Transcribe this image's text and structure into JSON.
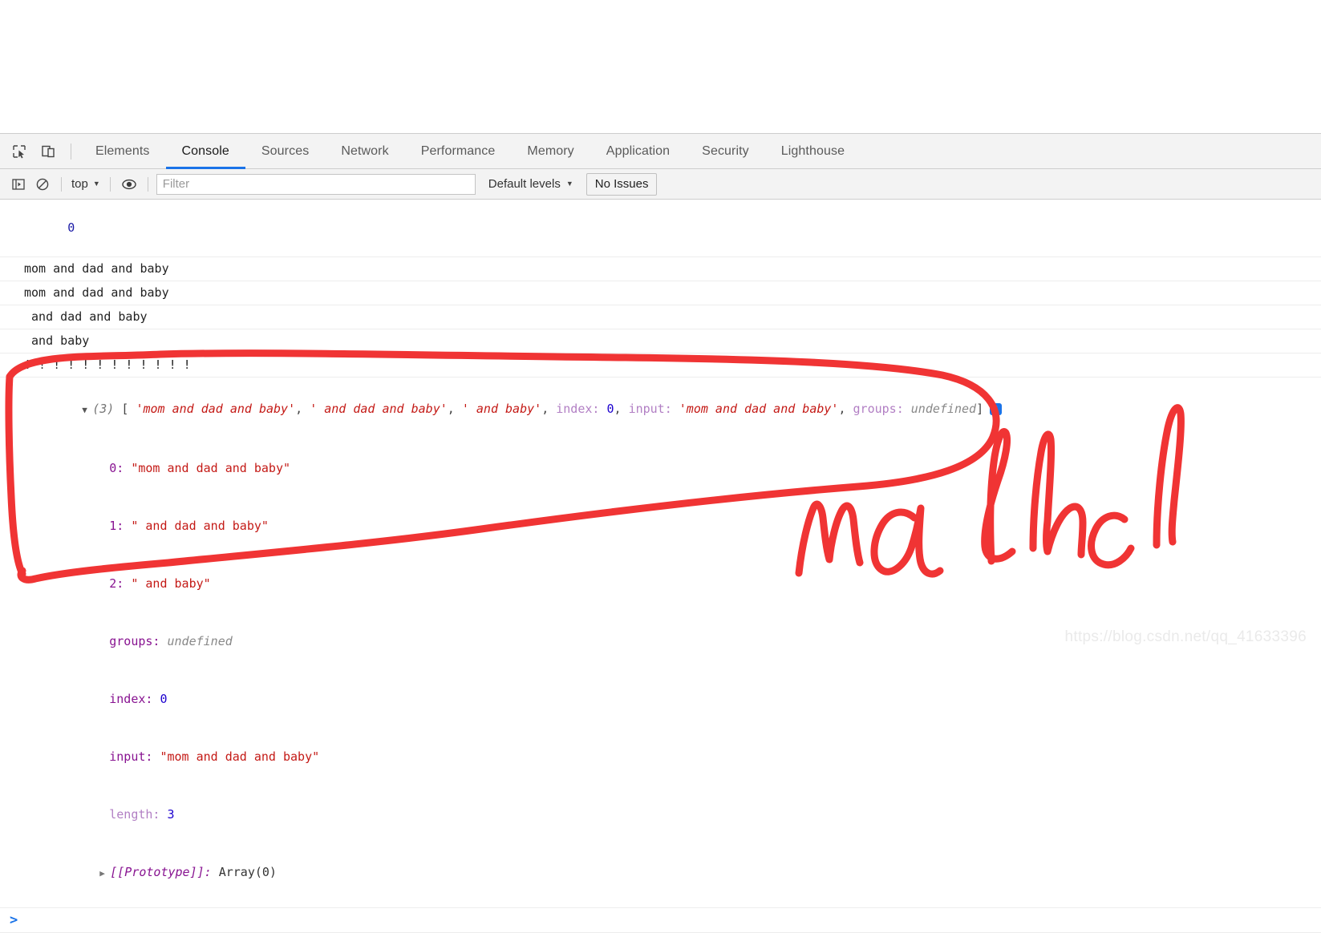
{
  "window": {
    "page_area_background": "#ffffff"
  },
  "devtools": {
    "toolbar_icons": [
      {
        "name": "inspect-element-icon",
        "glyph": "inspect"
      },
      {
        "name": "device-toolbar-icon",
        "glyph": "device"
      }
    ],
    "tabs": [
      {
        "label": "Elements",
        "active": false
      },
      {
        "label": "Console",
        "active": true
      },
      {
        "label": "Sources",
        "active": false
      },
      {
        "label": "Network",
        "active": false
      },
      {
        "label": "Performance",
        "active": false
      },
      {
        "label": "Memory",
        "active": false
      },
      {
        "label": "Application",
        "active": false
      },
      {
        "label": "Security",
        "active": false
      },
      {
        "label": "Lighthouse",
        "active": false
      }
    ],
    "accent_color": "#1a73e8"
  },
  "console_toolbar": {
    "sidebar_toggle_icon": "show-console-sidebar-icon",
    "clear_icon": "clear-console-icon",
    "context_selector": {
      "value": "top",
      "caret": "▼"
    },
    "eye_icon": "live-expression-icon",
    "filter": {
      "value": "",
      "placeholder": "Filter"
    },
    "levels": {
      "value": "Default levels",
      "caret": "▼"
    },
    "issues_button": "No Issues"
  },
  "console_messages": [
    {
      "type": "number",
      "text": "0"
    },
    {
      "type": "text",
      "text": "mom and dad and baby"
    },
    {
      "type": "text",
      "text": "mom and dad and baby"
    },
    {
      "type": "text",
      "text": " and dad and baby"
    },
    {
      "type": "text",
      "text": " and baby"
    },
    {
      "type": "text",
      "text": "! ! ! ! ! ! ! ! ! ! ! !"
    }
  ],
  "array_result": {
    "expand_arrow": "▼",
    "count_label": "(3)",
    "open_bracket": "[",
    "close_bracket": "]",
    "preview_items": [
      "'mom and dad and baby'",
      "' and dad and baby'",
      "' and baby'"
    ],
    "preview_index_key": "index:",
    "preview_index_value": "0",
    "preview_input_key": "input:",
    "preview_input_value": "'mom and dad and baby'",
    "preview_groups_key": "groups:",
    "preview_groups_value": "undefined",
    "info_badge": "i",
    "properties": [
      {
        "key": "0:",
        "value": "\"mom and dad and baby\"",
        "value_kind": "string"
      },
      {
        "key": "1:",
        "value": "\" and dad and baby\"",
        "value_kind": "string"
      },
      {
        "key": "2:",
        "value": "\" and baby\"",
        "value_kind": "string"
      },
      {
        "key": "groups:",
        "value": "undefined",
        "value_kind": "undefined"
      },
      {
        "key": "index:",
        "value": "0",
        "value_kind": "number"
      },
      {
        "key": "input:",
        "value": "\"mom and dad and baby\"",
        "value_kind": "string"
      },
      {
        "key": "length:",
        "value": "3",
        "value_kind": "number"
      }
    ],
    "prototype": {
      "arrow": "▶",
      "key": "[[Prototype]]:",
      "value": "Array(0)"
    }
  },
  "prompt": {
    "chevron": ">",
    "value": "",
    "placeholder": ""
  },
  "annotation": {
    "color": "#f03434",
    "handwriting_text": "match",
    "description": "red hand-drawn circle around the array result and the handwritten word"
  },
  "watermark": {
    "text": "https://blog.csdn.net/qq_41633396"
  }
}
